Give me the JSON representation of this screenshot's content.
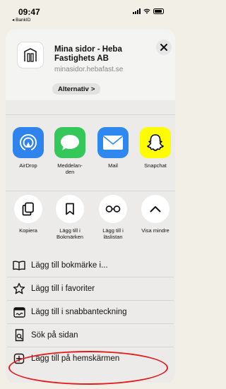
{
  "status_bar": {
    "time": "09:47",
    "back_app": "◂ BankID"
  },
  "header": {
    "site_title": "Mina sidor - Heba Fastighets AB",
    "url": "minasidor.hebafast.se",
    "options_label": "Alternativ",
    "options_chevron": ">"
  },
  "share_apps": [
    {
      "label": "AirDrop",
      "icon": "airdrop-icon",
      "color": "#2f83ec"
    },
    {
      "label": "Meddelan-den",
      "icon": "messages-icon",
      "color": "#34c759"
    },
    {
      "label": "Mail",
      "icon": "mail-icon",
      "color": "#2f88f0"
    },
    {
      "label": "Snapchat",
      "icon": "snapchat-icon",
      "color": "#fffc00"
    }
  ],
  "actions": [
    {
      "label": "Kopiera",
      "icon": "copy-icon"
    },
    {
      "label": "Lägg till i Bokmärken",
      "icon": "bookmark-icon"
    },
    {
      "label": "Lägg till i läslistan",
      "icon": "glasses-icon"
    },
    {
      "label": "Visa mindre",
      "icon": "chevron-up-icon"
    }
  ],
  "menu": [
    {
      "label": "Lägg till bokmärke i...",
      "icon": "book-icon"
    },
    {
      "label": "Lägg till i favoriter",
      "icon": "star-icon"
    },
    {
      "label": "Lägg till i snabbanteckning",
      "icon": "quick-note-icon"
    },
    {
      "label": "Sök på sidan",
      "icon": "find-in-page-icon"
    },
    {
      "label": "Lägg till på hemskärmen",
      "icon": "add-square-icon"
    }
  ],
  "colors": {
    "highlight": "#e41b1b"
  }
}
